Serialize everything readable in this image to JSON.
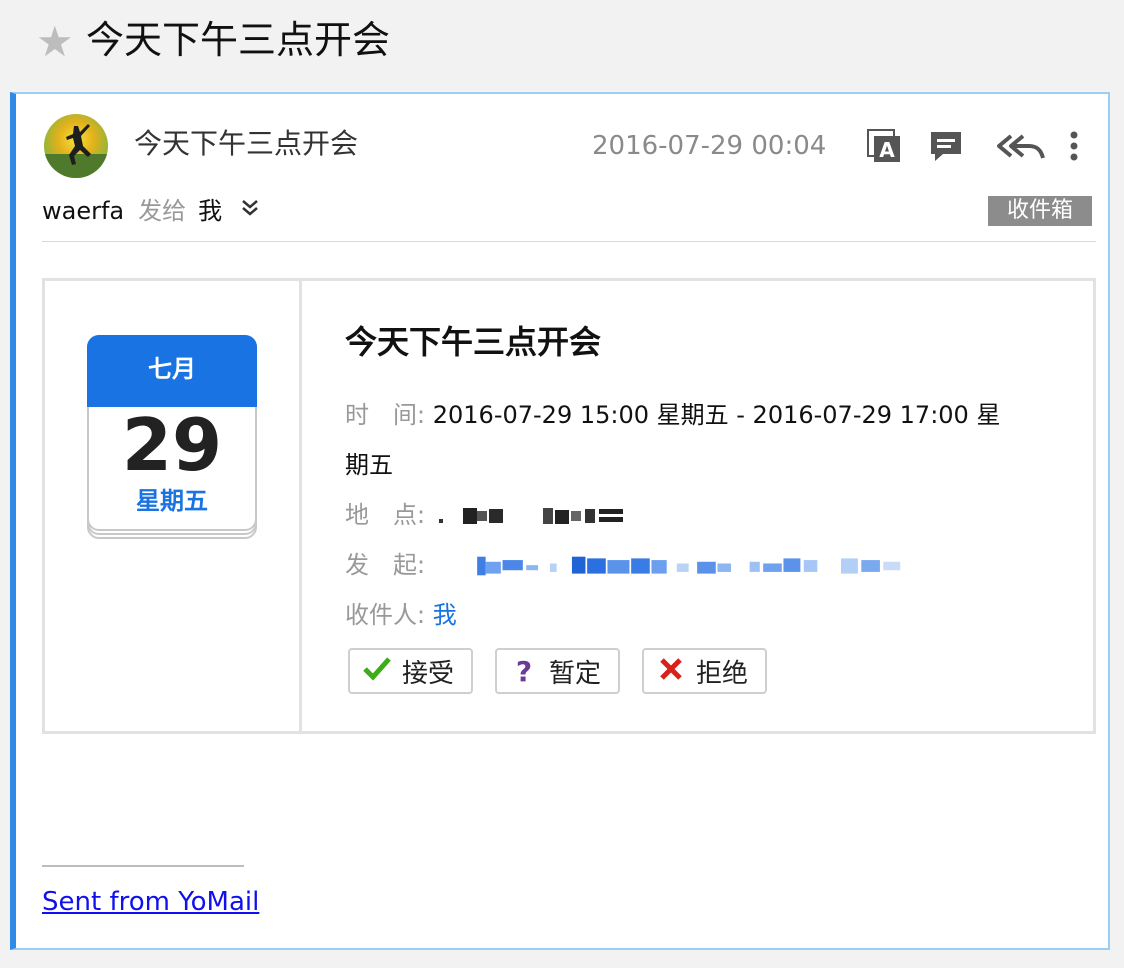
{
  "header": {
    "star_icon": "star-icon",
    "subject": "今天下午三点开会"
  },
  "message": {
    "sender_subject": "今天下午三点开会",
    "datetime": "2016-07-29 00:04",
    "from": "waerfa",
    "sent_to_label": "发给",
    "recipient": "我",
    "folder": "收件箱",
    "toolbar": [
      "translate-icon",
      "comment-icon",
      "reply-all-icon",
      "more-vertical-icon"
    ]
  },
  "invite": {
    "calendar": {
      "month": "七月",
      "day": "29",
      "weekday": "星期五"
    },
    "title": "今天下午三点开会",
    "time_label": "时　间:",
    "time_value_line1": "2016-07-29 15:00 星期五 - 2016-07-29 17:00 星",
    "time_value_line2": "期五",
    "location_label": "地　点:",
    "organizer_label": "发　起:",
    "attendees_label": "收件人:",
    "attendees_value": "我",
    "buttons": {
      "accept": "接受",
      "tentative": "暂定",
      "decline": "拒绝"
    },
    "colors": {
      "accept": "#3cad18",
      "tentative": "#6b3b98",
      "decline": "#d9201b",
      "calendar_header": "#1a73e3"
    }
  },
  "signature": {
    "link_text": "Sent from YoMail"
  }
}
